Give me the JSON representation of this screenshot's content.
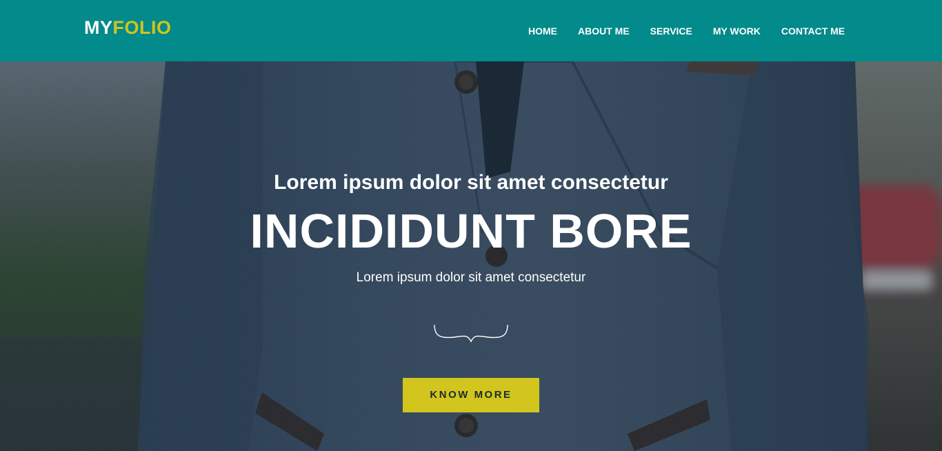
{
  "brand": {
    "logo_part1": "MY",
    "logo_part2": "FOLIO"
  },
  "nav": {
    "items": [
      {
        "label": "HOME"
      },
      {
        "label": "ABOUT ME"
      },
      {
        "label": "SERVICE"
      },
      {
        "label": "MY WORK"
      },
      {
        "label": "CONTACT ME"
      }
    ]
  },
  "hero": {
    "subtitle": "Lorem ipsum dolor sit amet consectetur",
    "title": "INCIDIDUNT BORE",
    "text": "Lorem ipsum dolor sit amet consectetur",
    "button_label": "KNOW MORE"
  },
  "colors": {
    "header_bg": "#028b8a",
    "accent": "#d2c51d",
    "text": "#ffffff"
  },
  "icons": {
    "divider": "curly-brace-divider-icon"
  }
}
